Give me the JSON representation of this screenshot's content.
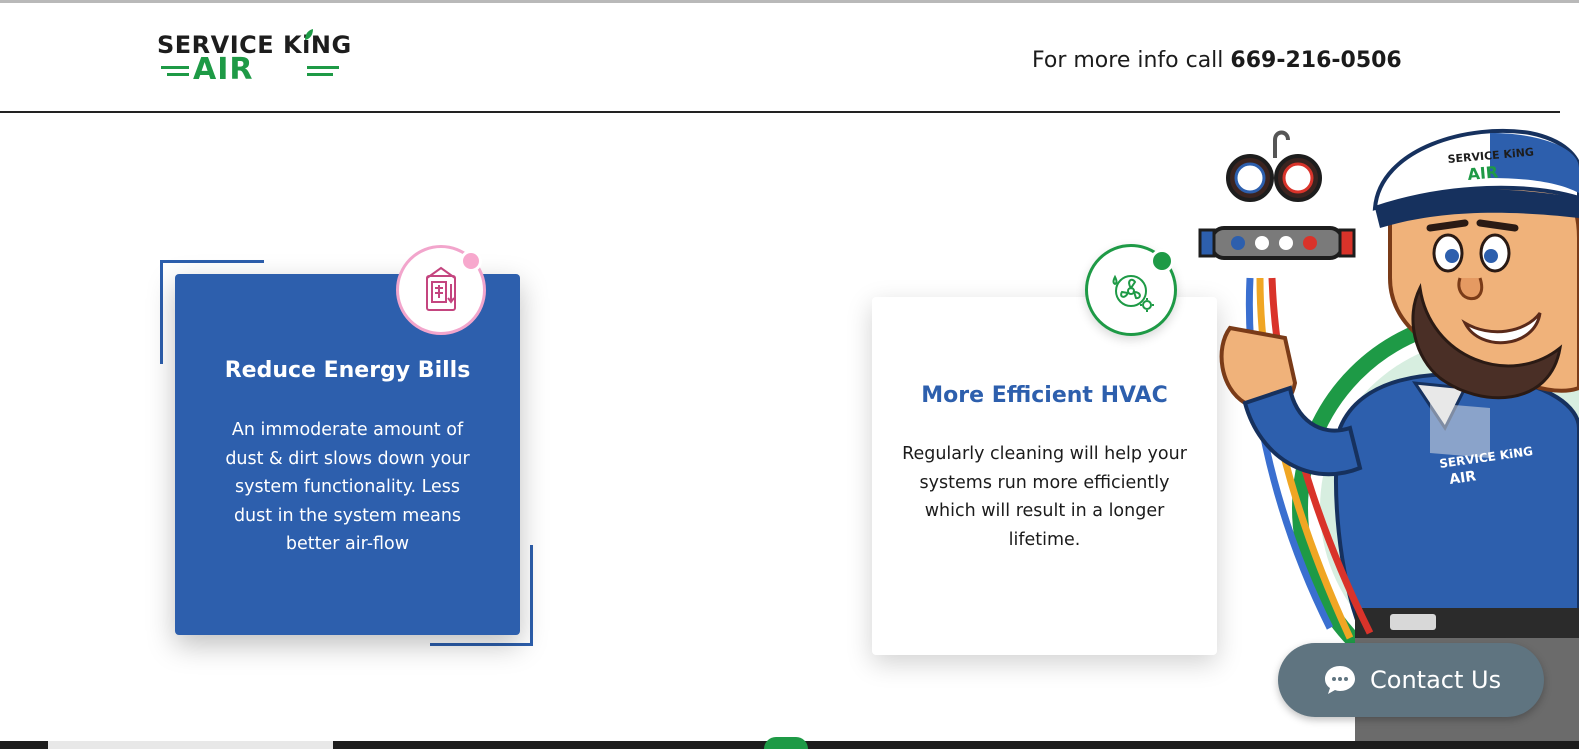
{
  "header": {
    "logo": {
      "line1": "SERVICE KiNG",
      "line2": "AIR"
    },
    "phone_prefix": "For more info call ",
    "phone_number": "669-216-0506"
  },
  "cards": [
    {
      "title": "Reduce Energy Bills",
      "body": "An immoderate amount of dust & dirt slows down your system functionality. Less dust in the system means better air-flow",
      "icon": "energy-meter-icon"
    },
    {
      "title": "More Efficient HVAC",
      "body": "Regularly cleaning will help your systems run more efficiently which will result in a longer lifetime.",
      "icon": "hvac-fan-icon"
    }
  ],
  "mascot": {
    "cap_text": "SERVICE KiNG AIR",
    "shirt_text": "SERVICE KiNG AIR"
  },
  "contact_button": {
    "label": "Contact Us",
    "icon": "chat-bubble-icon"
  },
  "colors": {
    "brand_blue": "#2d5fad",
    "brand_green": "#1e9a46",
    "accent_pink": "#f2a5cc",
    "contact_bg": "#5f7480"
  }
}
